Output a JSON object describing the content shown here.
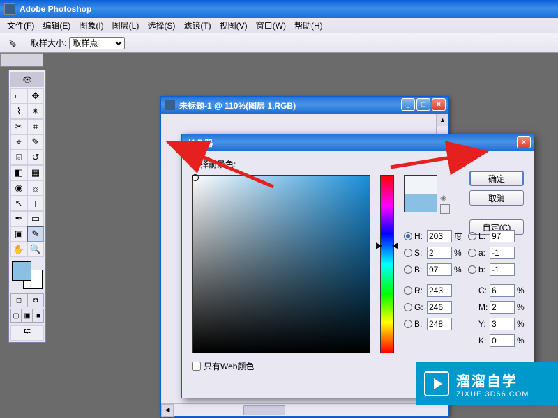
{
  "app": {
    "title": "Adobe Photoshop"
  },
  "menu": {
    "items": [
      "文件(F)",
      "编辑(E)",
      "图象(I)",
      "图层(L)",
      "选择(S)",
      "滤镜(T)",
      "视图(V)",
      "窗口(W)",
      "帮助(H)"
    ]
  },
  "options": {
    "sample_size_label": "取样大小:",
    "sample_size_value": "取样点"
  },
  "tools": {
    "fg_color": "#8bc0e5",
    "bg_color": "#ffffff"
  },
  "doc": {
    "title": "未标题-1 @ 110%(图层 1,RGB)"
  },
  "picker": {
    "title": "拾色器",
    "select_label": "选择前景色:",
    "ok": "确定",
    "cancel": "取消",
    "custom": "自定(C)",
    "web_only": "只有Web颜色",
    "preview_new": "#f1f5f9",
    "preview_old": "#8bc0e5",
    "hsb": {
      "H": "203",
      "H_unit": "度",
      "S": "2",
      "S_unit": "%",
      "B": "97",
      "B_unit": "%"
    },
    "lab": {
      "L": "97",
      "a": "-1",
      "b": "-1"
    },
    "rgb": {
      "R": "243",
      "G": "246",
      "Bv": "248"
    },
    "cmyk": {
      "C": "6",
      "C_unit": "%",
      "M": "2",
      "M_unit": "%",
      "Y": "3",
      "Y_unit": "%",
      "K": "0",
      "K_unit": "%"
    }
  },
  "watermark": {
    "brand": "溜溜自学",
    "url": "ZIXUE.3D66.COM"
  }
}
